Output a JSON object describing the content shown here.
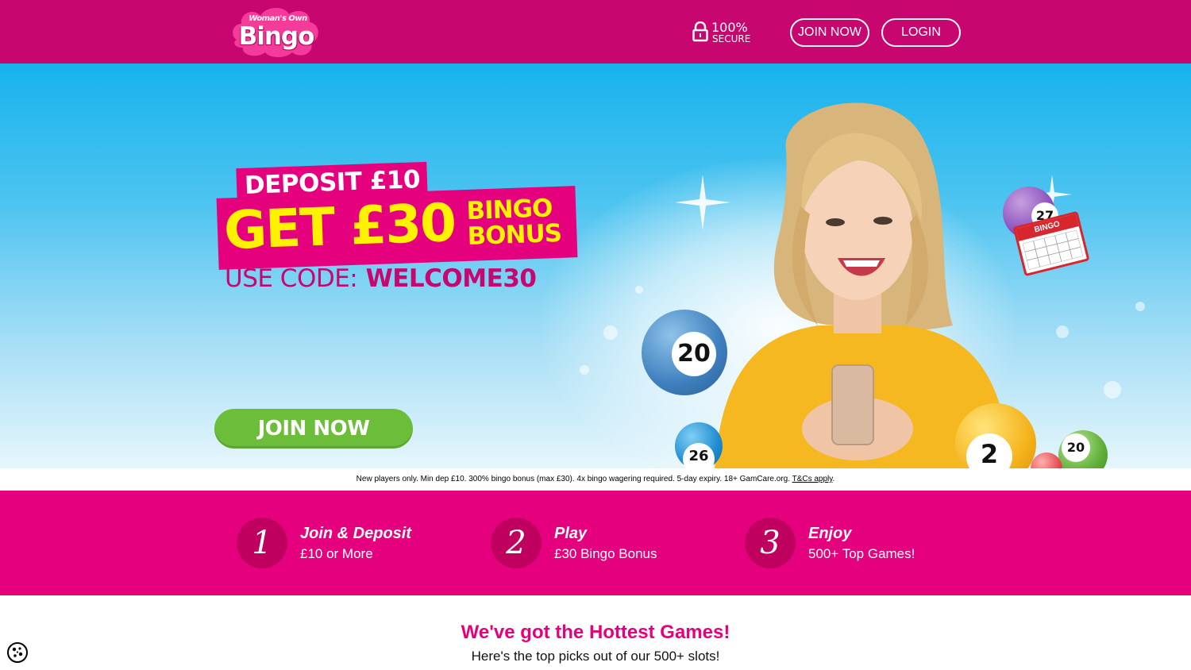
{
  "header": {
    "logo_small": "Woman's Own",
    "logo_big": "Bingo",
    "secure_pct": "100%",
    "secure_word": "SECURE",
    "join_label": "JOIN NOW",
    "login_label": "LOGIN"
  },
  "hero": {
    "deposit": "DEPOSIT £10",
    "get": "GET £30",
    "bingo": "BINGO",
    "bonus": "BONUS",
    "code_label": "USE CODE:",
    "code_value": "WELCOME30",
    "join_label": "JOIN NOW",
    "balls": [
      "20",
      "27",
      "26",
      "2",
      "20"
    ],
    "ticket_label": "BINGO"
  },
  "terms": {
    "text": "New players only. Min dep £10. 300% bingo bonus (max £30). 4x bingo wagering required. 5-day expiry. 18+ GamCare.org. ",
    "link": "T&Cs apply",
    "end": "."
  },
  "steps": [
    {
      "num": "1",
      "title": "Join & Deposit",
      "sub": "£10 or More"
    },
    {
      "num": "2",
      "title": "Play",
      "sub": "£30 Bingo Bonus"
    },
    {
      "num": "3",
      "title": "Enjoy",
      "sub": "500+ Top Games!"
    }
  ],
  "games": {
    "title": "We've got the Hottest Games!",
    "subtitle": "Here's the top picks out of our 500+ slots!"
  },
  "colors": {
    "header_bg": "#c8066f",
    "brand_pink": "#e5007d",
    "cta_green": "#6cbd3a",
    "bonus_yellow": "#fff200"
  },
  "icons": {
    "lock": "lock-icon",
    "cookie": "cookie-icon"
  }
}
